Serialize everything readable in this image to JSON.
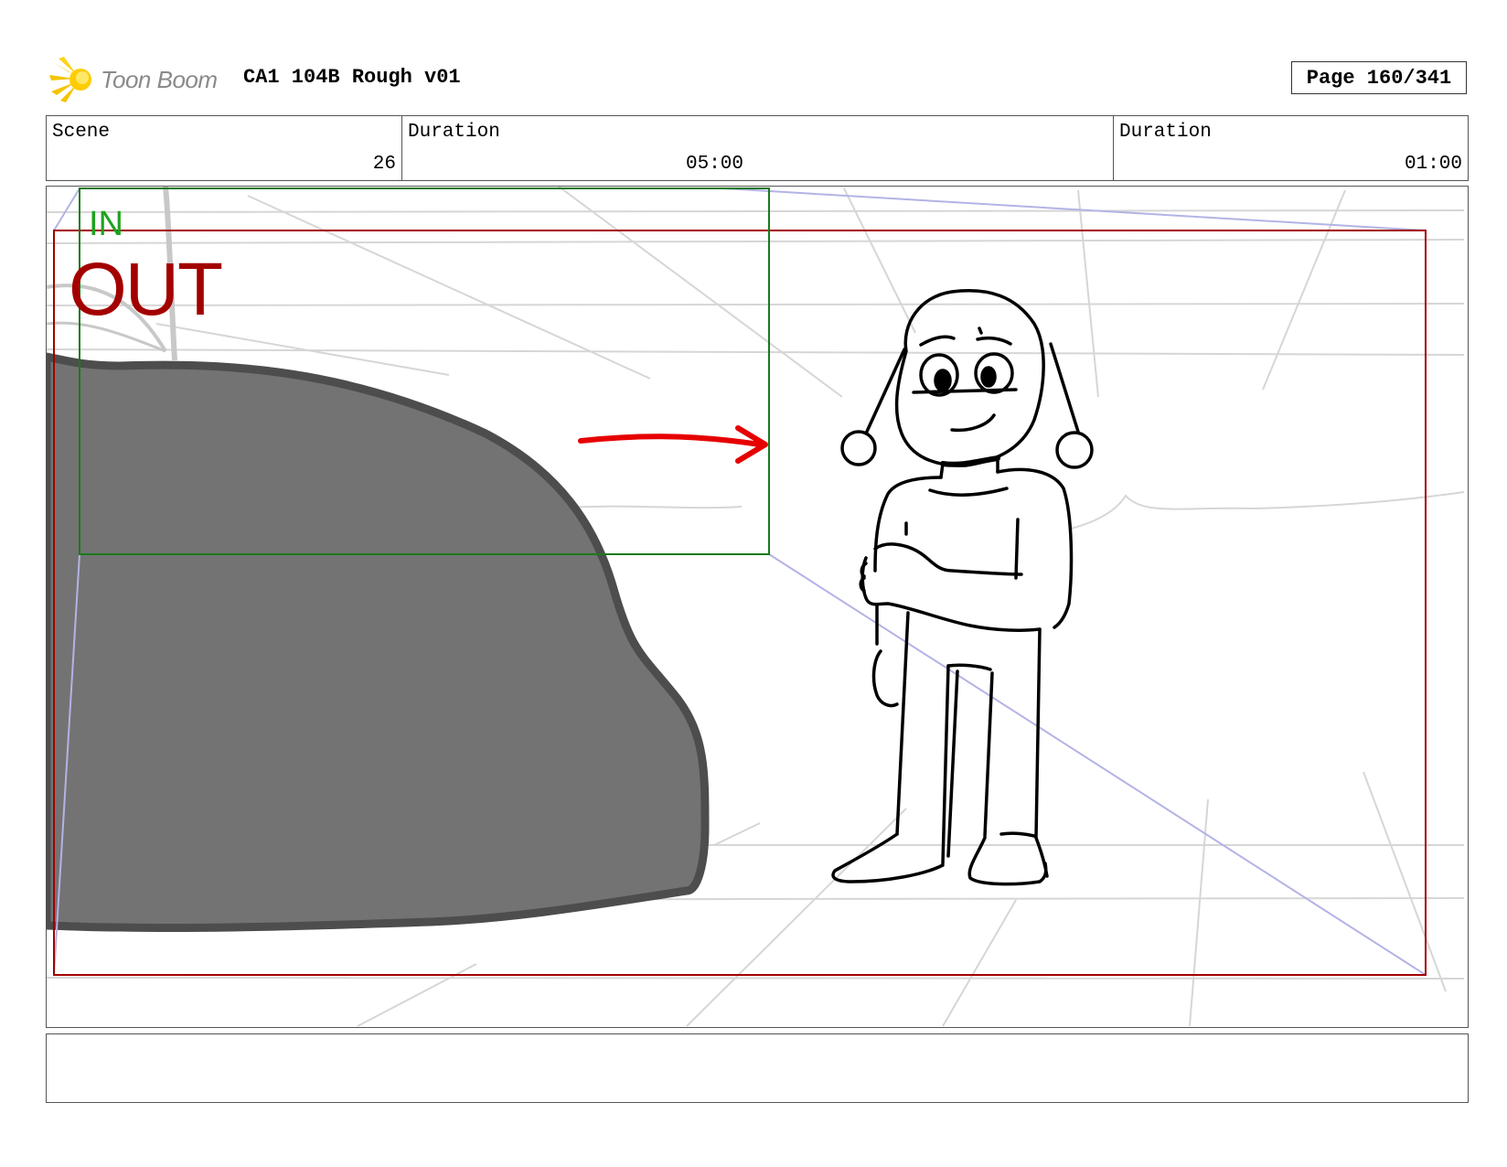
{
  "header": {
    "logo_text": "Toon Boom",
    "project_title": "CA1 104B Rough v01",
    "page_label": "Page 160/341"
  },
  "info": {
    "scene_label": "Scene",
    "scene_value": "26",
    "duration1_label": "Duration",
    "duration1_value": "05:00",
    "duration2_label": "Duration",
    "duration2_value": "01:00"
  },
  "panel": {
    "in_label": "IN",
    "out_label": "OUT"
  },
  "notes": {
    "text": ""
  },
  "colors": {
    "in_frame": "#1a7a1a",
    "out_frame": "#a30000",
    "arrow": "#e60000",
    "perspective_lines": "#b3b3e6",
    "foreground_shape": "#737373",
    "sketch_lines": "#d0d0d0"
  }
}
